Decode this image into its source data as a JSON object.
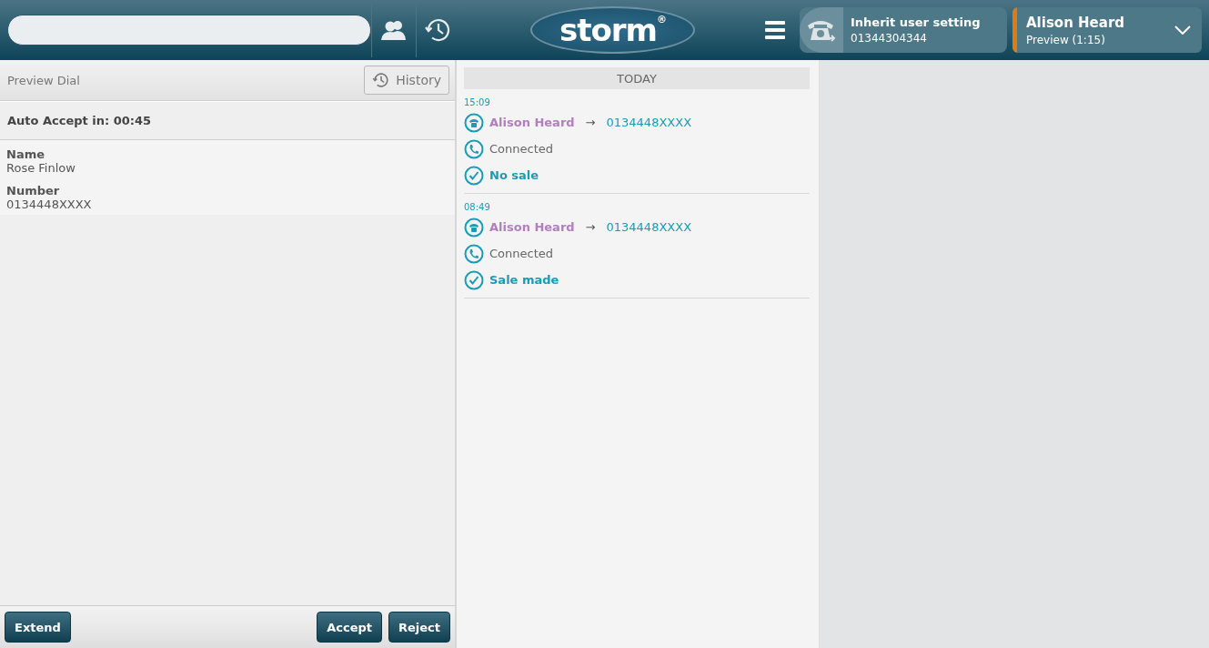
{
  "header": {
    "logo": {
      "text": "storm",
      "mark": "®"
    },
    "line": {
      "title": "Inherit user setting",
      "number": "01344304344"
    },
    "agent": {
      "name": "Alison Heard",
      "status": "Preview (1:15)",
      "color": "#e07b10"
    }
  },
  "left_panel": {
    "title": "Preview Dial",
    "history_button": "History",
    "countdown": "Auto Accept in: 00:45",
    "fields": [
      {
        "label": "Name",
        "value": "Rose Finlow"
      },
      {
        "label": "Number",
        "value": "0134448XXXX"
      }
    ],
    "left_buttons": [
      "Extend"
    ],
    "right_buttons": [
      "Accept",
      "Reject"
    ]
  },
  "history": {
    "day": "TODAY",
    "entries": [
      {
        "time": "15:09",
        "steps": [
          {
            "kind": "call",
            "from": "Alison Heard",
            "arrow": "→",
            "to": "0134448XXXX"
          },
          {
            "kind": "connected",
            "text": "Connected"
          },
          {
            "kind": "outcome",
            "text": "No sale"
          }
        ]
      },
      {
        "time": "08:49",
        "steps": [
          {
            "kind": "call",
            "from": "Alison Heard",
            "arrow": "→",
            "to": "0134448XXXX"
          },
          {
            "kind": "connected",
            "text": "Connected"
          },
          {
            "kind": "outcome",
            "text": "Sale made"
          }
        ]
      }
    ]
  }
}
